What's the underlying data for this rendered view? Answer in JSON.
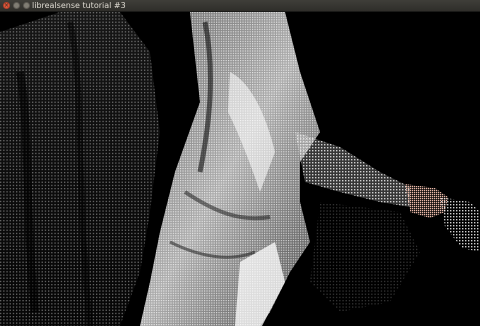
{
  "window": {
    "title": "librealsense tutorial #3"
  },
  "icons": {
    "close": "close-icon",
    "minimize": "minimize-icon",
    "maximize": "maximize-icon"
  },
  "colors": {
    "titlebar": "#3c3b37",
    "close_button": "#e0583a",
    "background": "#000000",
    "point_cloud": "#e6e6e6"
  }
}
